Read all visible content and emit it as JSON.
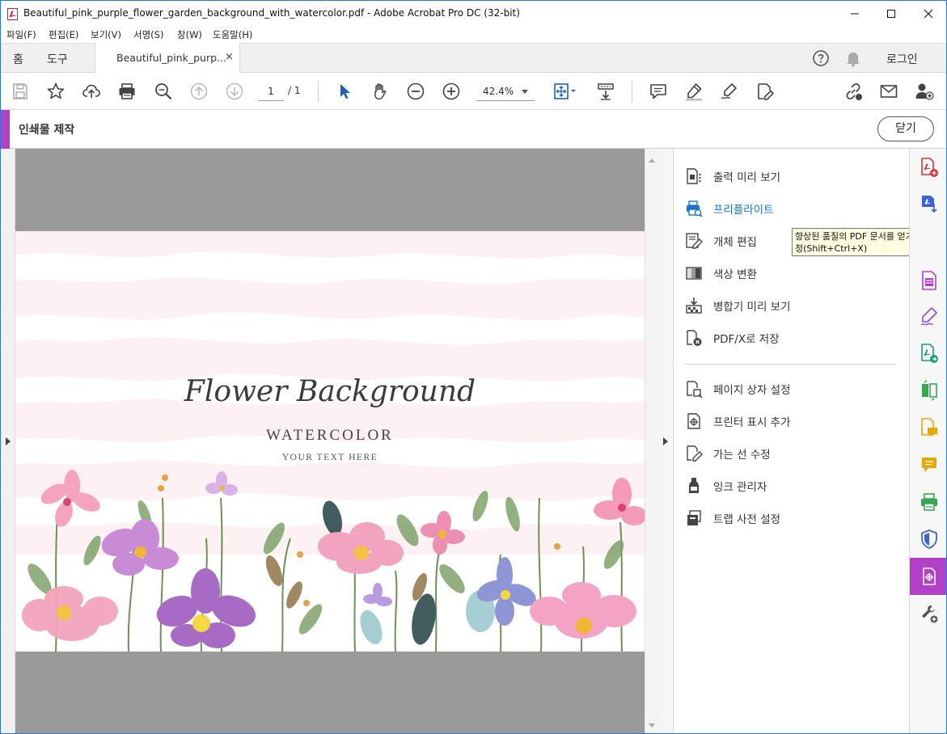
{
  "window": {
    "title": "Beautiful_pink_purple_flower_garden_background_with_watercolor.pdf - Adobe Acrobat Pro DC (32-bit)",
    "controls": [
      "minimize",
      "maximize",
      "close"
    ]
  },
  "menu": [
    "파일(F)",
    "편집(E)",
    "보기(V)",
    "서명(S)",
    "창(W)",
    "도움말(H)"
  ],
  "tabs": {
    "home": "홈",
    "tools": "도구",
    "document": "Beautiful_pink_purp...",
    "close_glyph": "×",
    "login": "로그인"
  },
  "toolbar": {
    "page_current": "1",
    "page_total": "/ 1",
    "zoom": "42.4%",
    "icons": [
      "save-icon",
      "star-icon",
      "cloud-upload-icon",
      "print-icon",
      "zoom-search-icon",
      "page-up-icon",
      "page-down-icon",
      "select-arrow-icon",
      "hand-icon",
      "zoom-out-icon",
      "zoom-in-icon",
      "fit-page-icon",
      "scroll-mode-icon",
      "comment-icon",
      "highlight-icon",
      "sign-icon",
      "edit-icon",
      "link-share-icon",
      "email-icon",
      "add-user-icon"
    ]
  },
  "tool_header": {
    "name": "인쇄물 제작",
    "close_label": "닫기",
    "accent": "#b540c8"
  },
  "document": {
    "title_script": "Flower Background",
    "subtitle": "WATERCOLOR",
    "tagline": "YOUR TEXT HERE"
  },
  "panel": {
    "items": [
      {
        "label": "출력 미리 보기",
        "icon": "output-preview-icon"
      },
      {
        "label": "프리플라이트",
        "icon": "preflight-icon",
        "active": true
      },
      {
        "label": "개체 편집",
        "icon": "edit-object-icon"
      },
      {
        "label": "색상 변환",
        "icon": "convert-colors-icon"
      },
      {
        "label": "병합기 미리 보기",
        "icon": "flattener-preview-icon"
      },
      {
        "label": "PDF/X로 저장",
        "icon": "save-pdfx-icon"
      },
      {
        "label": "페이지 상자 설정",
        "icon": "page-boxes-icon"
      },
      {
        "label": "프린터 표시 추가",
        "icon": "printer-marks-icon"
      },
      {
        "label": "가는 선 수정",
        "icon": "fix-hairlines-icon"
      },
      {
        "label": "잉크 관리자",
        "icon": "ink-manager-icon"
      },
      {
        "label": "트랩 사전 설정",
        "icon": "trap-presets-icon"
      }
    ],
    "tooltip_line1": "향상된 품질의 PDF 문서를 얻기 위해",
    "tooltip_line2": "정(Shift+Ctrl+X)"
  },
  "rail": {
    "icons": [
      "create-pdf-icon",
      "export-pdf-icon",
      "rail-hidden-icon",
      "organize-pages-icon",
      "fill-sign-icon",
      "send-for-review-icon",
      "compare-files-icon",
      "comment-tool-icon",
      "sticky-note-icon",
      "print-production-tool-icon",
      "protect-icon",
      "print-production-active-icon",
      "more-tools-icon"
    ],
    "active_color": "#b540c8"
  }
}
